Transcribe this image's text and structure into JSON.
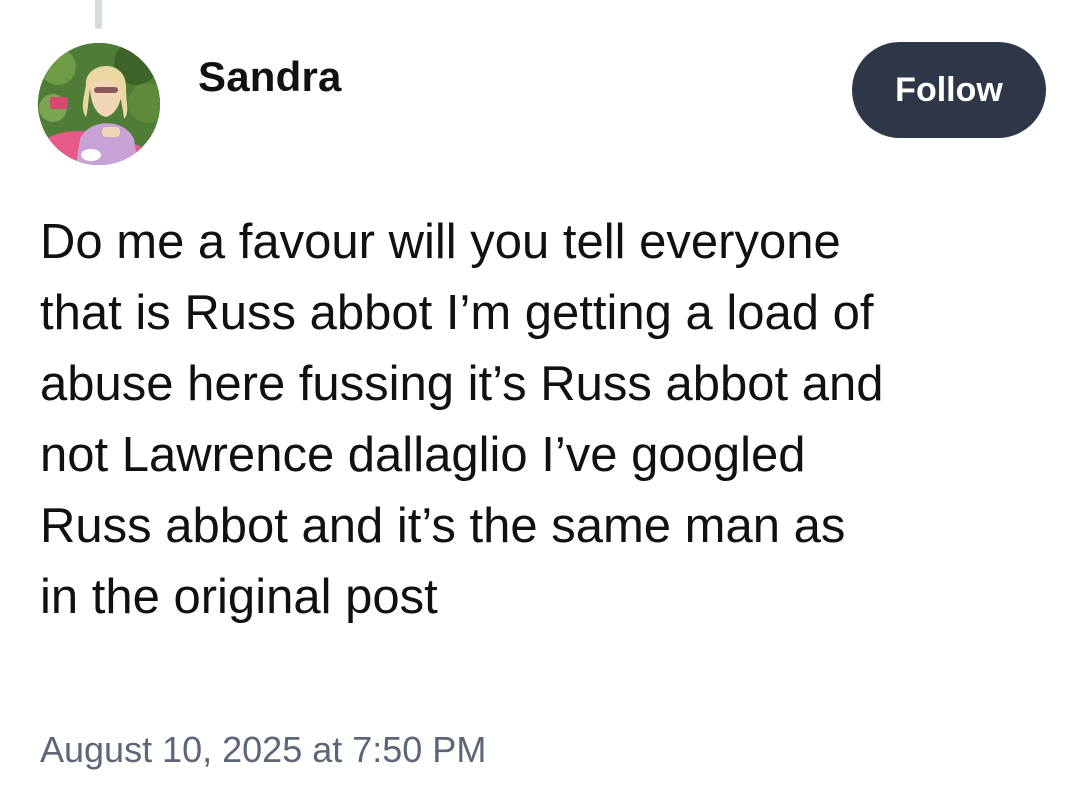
{
  "post": {
    "author": {
      "name": "Sandra"
    },
    "follow_label": "Follow",
    "body": "Do me a favour will you tell everyone\nthat is Russ abbot I’m getting a load of\nabuse here fussing it’s Russ abbot and\nnot Lawrence dallaglio I’ve googled\nRuss abbot and it’s  the same man as\nin the original post",
    "timestamp": "August 10, 2025 at 7:50 PM"
  },
  "colors": {
    "follow_button_bg": "#2d3748",
    "follow_button_text": "#ffffff",
    "timestamp_text": "#5b6676",
    "body_text": "#111111"
  }
}
